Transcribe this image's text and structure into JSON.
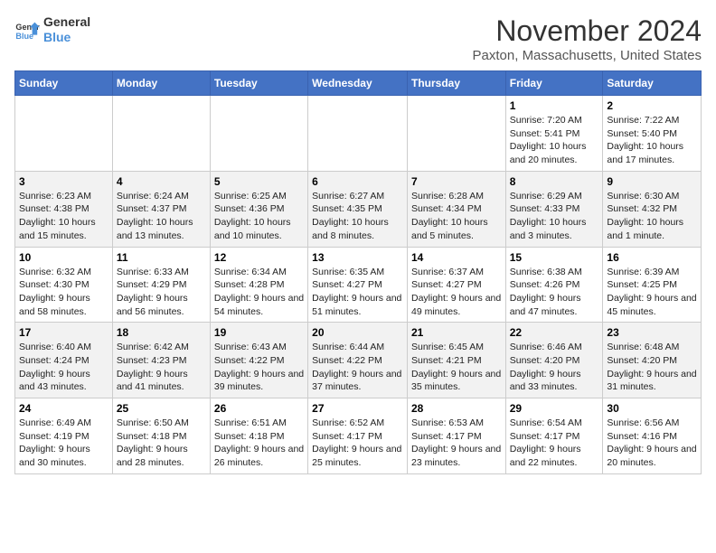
{
  "logo": {
    "line1": "General",
    "line2": "Blue"
  },
  "title": "November 2024",
  "location": "Paxton, Massachusetts, United States",
  "days_header": [
    "Sunday",
    "Monday",
    "Tuesday",
    "Wednesday",
    "Thursday",
    "Friday",
    "Saturday"
  ],
  "weeks": [
    [
      {
        "day": "",
        "info": ""
      },
      {
        "day": "",
        "info": ""
      },
      {
        "day": "",
        "info": ""
      },
      {
        "day": "",
        "info": ""
      },
      {
        "day": "",
        "info": ""
      },
      {
        "day": "1",
        "info": "Sunrise: 7:20 AM\nSunset: 5:41 PM\nDaylight: 10 hours and 20 minutes."
      },
      {
        "day": "2",
        "info": "Sunrise: 7:22 AM\nSunset: 5:40 PM\nDaylight: 10 hours and 17 minutes."
      }
    ],
    [
      {
        "day": "3",
        "info": "Sunrise: 6:23 AM\nSunset: 4:38 PM\nDaylight: 10 hours and 15 minutes."
      },
      {
        "day": "4",
        "info": "Sunrise: 6:24 AM\nSunset: 4:37 PM\nDaylight: 10 hours and 13 minutes."
      },
      {
        "day": "5",
        "info": "Sunrise: 6:25 AM\nSunset: 4:36 PM\nDaylight: 10 hours and 10 minutes."
      },
      {
        "day": "6",
        "info": "Sunrise: 6:27 AM\nSunset: 4:35 PM\nDaylight: 10 hours and 8 minutes."
      },
      {
        "day": "7",
        "info": "Sunrise: 6:28 AM\nSunset: 4:34 PM\nDaylight: 10 hours and 5 minutes."
      },
      {
        "day": "8",
        "info": "Sunrise: 6:29 AM\nSunset: 4:33 PM\nDaylight: 10 hours and 3 minutes."
      },
      {
        "day": "9",
        "info": "Sunrise: 6:30 AM\nSunset: 4:32 PM\nDaylight: 10 hours and 1 minute."
      }
    ],
    [
      {
        "day": "10",
        "info": "Sunrise: 6:32 AM\nSunset: 4:30 PM\nDaylight: 9 hours and 58 minutes."
      },
      {
        "day": "11",
        "info": "Sunrise: 6:33 AM\nSunset: 4:29 PM\nDaylight: 9 hours and 56 minutes."
      },
      {
        "day": "12",
        "info": "Sunrise: 6:34 AM\nSunset: 4:28 PM\nDaylight: 9 hours and 54 minutes."
      },
      {
        "day": "13",
        "info": "Sunrise: 6:35 AM\nSunset: 4:27 PM\nDaylight: 9 hours and 51 minutes."
      },
      {
        "day": "14",
        "info": "Sunrise: 6:37 AM\nSunset: 4:27 PM\nDaylight: 9 hours and 49 minutes."
      },
      {
        "day": "15",
        "info": "Sunrise: 6:38 AM\nSunset: 4:26 PM\nDaylight: 9 hours and 47 minutes."
      },
      {
        "day": "16",
        "info": "Sunrise: 6:39 AM\nSunset: 4:25 PM\nDaylight: 9 hours and 45 minutes."
      }
    ],
    [
      {
        "day": "17",
        "info": "Sunrise: 6:40 AM\nSunset: 4:24 PM\nDaylight: 9 hours and 43 minutes."
      },
      {
        "day": "18",
        "info": "Sunrise: 6:42 AM\nSunset: 4:23 PM\nDaylight: 9 hours and 41 minutes."
      },
      {
        "day": "19",
        "info": "Sunrise: 6:43 AM\nSunset: 4:22 PM\nDaylight: 9 hours and 39 minutes."
      },
      {
        "day": "20",
        "info": "Sunrise: 6:44 AM\nSunset: 4:22 PM\nDaylight: 9 hours and 37 minutes."
      },
      {
        "day": "21",
        "info": "Sunrise: 6:45 AM\nSunset: 4:21 PM\nDaylight: 9 hours and 35 minutes."
      },
      {
        "day": "22",
        "info": "Sunrise: 6:46 AM\nSunset: 4:20 PM\nDaylight: 9 hours and 33 minutes."
      },
      {
        "day": "23",
        "info": "Sunrise: 6:48 AM\nSunset: 4:20 PM\nDaylight: 9 hours and 31 minutes."
      }
    ],
    [
      {
        "day": "24",
        "info": "Sunrise: 6:49 AM\nSunset: 4:19 PM\nDaylight: 9 hours and 30 minutes."
      },
      {
        "day": "25",
        "info": "Sunrise: 6:50 AM\nSunset: 4:18 PM\nDaylight: 9 hours and 28 minutes."
      },
      {
        "day": "26",
        "info": "Sunrise: 6:51 AM\nSunset: 4:18 PM\nDaylight: 9 hours and 26 minutes."
      },
      {
        "day": "27",
        "info": "Sunrise: 6:52 AM\nSunset: 4:17 PM\nDaylight: 9 hours and 25 minutes."
      },
      {
        "day": "28",
        "info": "Sunrise: 6:53 AM\nSunset: 4:17 PM\nDaylight: 9 hours and 23 minutes."
      },
      {
        "day": "29",
        "info": "Sunrise: 6:54 AM\nSunset: 4:17 PM\nDaylight: 9 hours and 22 minutes."
      },
      {
        "day": "30",
        "info": "Sunrise: 6:56 AM\nSunset: 4:16 PM\nDaylight: 9 hours and 20 minutes."
      }
    ]
  ]
}
